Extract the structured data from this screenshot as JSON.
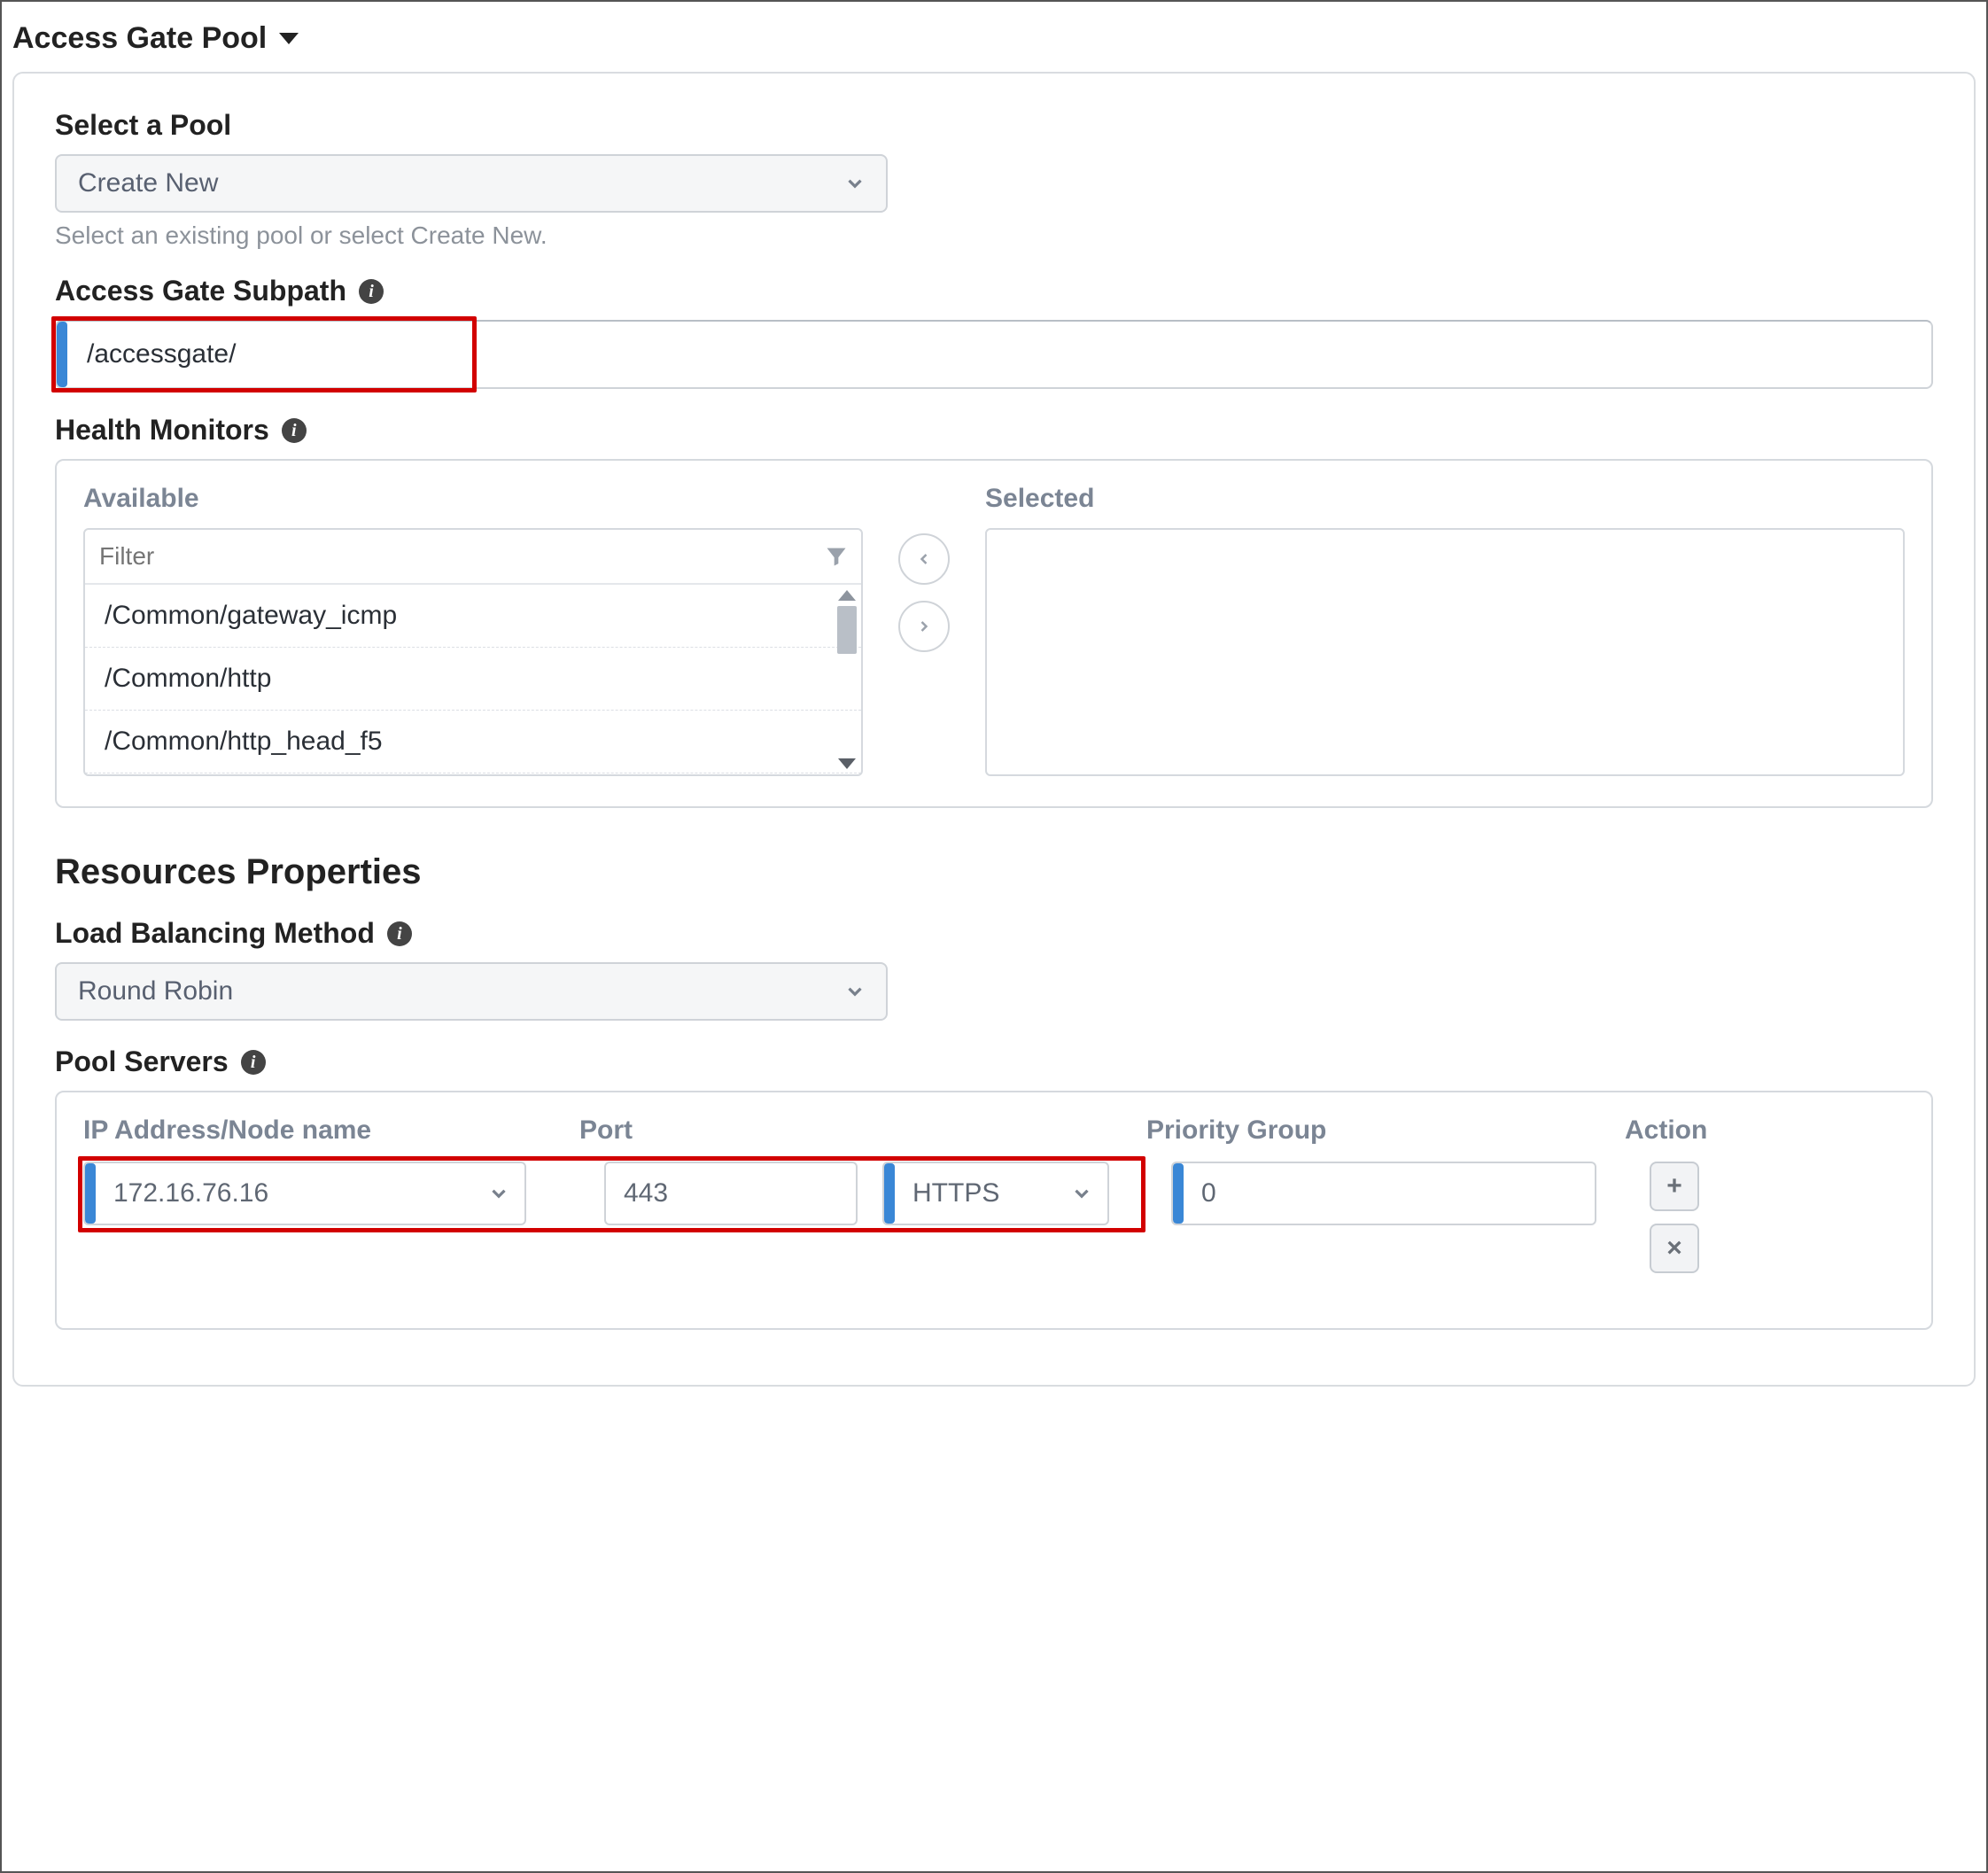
{
  "section": {
    "title": "Access Gate Pool"
  },
  "pool_select": {
    "label": "Select a Pool",
    "value": "Create New",
    "helper": "Select an existing pool or select Create New."
  },
  "subpath": {
    "label": "Access Gate Subpath",
    "value": "/accessgate/"
  },
  "monitors": {
    "label": "Health Monitors",
    "available_label": "Available",
    "selected_label": "Selected",
    "filter_placeholder": "Filter",
    "available": [
      "/Common/gateway_icmp",
      "/Common/http",
      "/Common/http_head_f5"
    ]
  },
  "resources": {
    "heading": "Resources Properties"
  },
  "lb_method": {
    "label": "Load Balancing Method",
    "value": "Round Robin"
  },
  "servers": {
    "label": "Pool Servers",
    "headers": {
      "ip": "IP Address/Node name",
      "port": "Port",
      "priority": "Priority Group",
      "action": "Action"
    },
    "rows": [
      {
        "ip": "172.16.76.16",
        "port": "443",
        "protocol": "HTTPS",
        "priority": "0"
      }
    ]
  }
}
